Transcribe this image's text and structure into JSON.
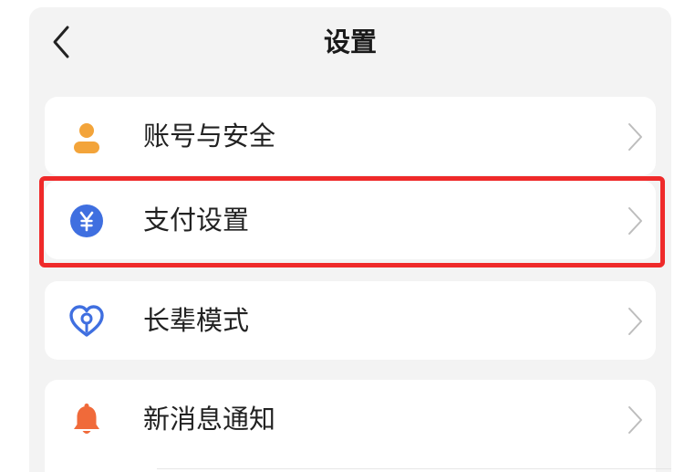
{
  "header": {
    "title": "设置",
    "back_icon": "chevron-left-icon"
  },
  "settings": {
    "items": [
      {
        "label": "账号与安全",
        "icon": "user-icon",
        "icon_color": "#f3a43a"
      },
      {
        "label": "支付设置",
        "icon": "yuan-icon",
        "icon_color": "#3f6fe0"
      },
      {
        "label": "长辈模式",
        "icon": "heart-icon",
        "icon_color": "#3f6fe0"
      },
      {
        "label": "新消息通知",
        "icon": "bell-icon",
        "icon_color": "#f06a3a"
      }
    ]
  },
  "highlight": {
    "target": "支付设置",
    "color": "#ef2a2a"
  }
}
